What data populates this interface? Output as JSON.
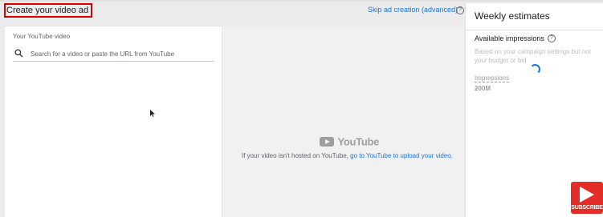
{
  "header": {
    "title": "Create your video ad",
    "skip_link": "Skip ad creation (advanced)",
    "help_glyph": "?"
  },
  "video_card": {
    "label": "Your YouTube video",
    "search_placeholder": "Search for a video or paste the URL from YouTube",
    "search_value": ""
  },
  "preview": {
    "logo_text": "YouTube",
    "note_prefix": "If your video isn't hosted on YouTube,",
    "note_link": "go to YouTube to upload your video."
  },
  "estimates": {
    "title": "Weekly estimates",
    "available_label": "Available impressions",
    "help_glyph": "?",
    "note": "Based on your campaign settings but not your budget or bid",
    "impressions_label": "Impressions",
    "impressions_value": "200M"
  },
  "overlay": {
    "subscribe_label": "SUBSCRIBE"
  },
  "colors": {
    "accent": "#1a73e8",
    "highlight_box": "#d50000",
    "subscribe_red": "#e52d27"
  },
  "icons": [
    "search-icon",
    "help-icon",
    "cursor-icon",
    "youtube-logo-icon",
    "loading-spinner-icon",
    "subscribe-play-icon"
  ]
}
